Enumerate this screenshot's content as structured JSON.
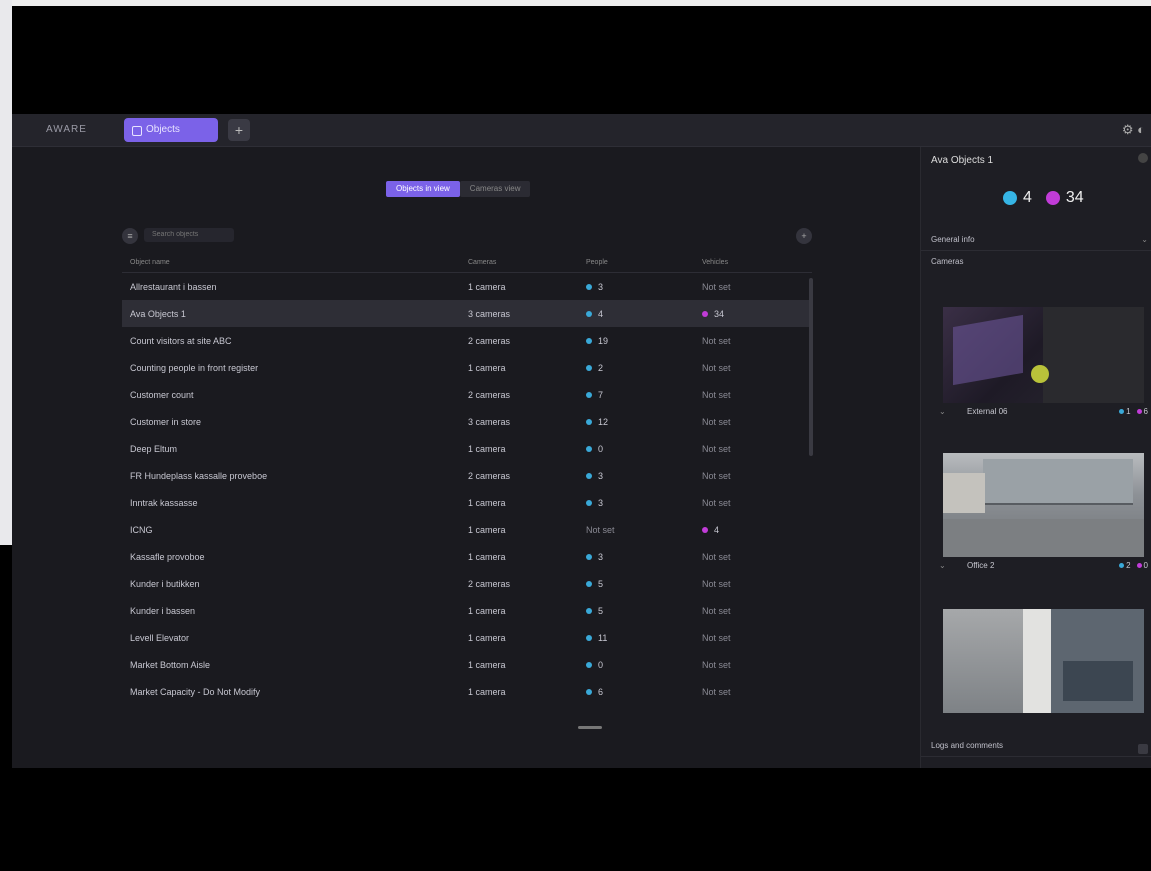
{
  "app": {
    "brand": "AWARE",
    "active_tab": "Objects",
    "add_tab_label": "+",
    "topbar_icons": [
      "settings-icon",
      "user-icon"
    ]
  },
  "view_toggle": {
    "active": "Objects in view",
    "inactive": "Cameras view"
  },
  "search": {
    "placeholder": "Search objects"
  },
  "table": {
    "headers": [
      "Object name",
      "Cameras",
      "People",
      "Vehicles"
    ],
    "rows": [
      {
        "name": "Allrestaurant i bassen",
        "cameras": "1 camera",
        "people": "3",
        "vehicles": "Not set",
        "p_dot": true,
        "v_dot": false
      },
      {
        "name": "Ava Objects 1",
        "cameras": "3 cameras",
        "people": "4",
        "vehicles": "34",
        "p_dot": true,
        "v_dot": true,
        "selected": true
      },
      {
        "name": "Count visitors at site ABC",
        "cameras": "2 cameras",
        "people": "19",
        "vehicles": "Not set",
        "p_dot": true,
        "v_dot": false
      },
      {
        "name": "Counting people in front register",
        "cameras": "1 camera",
        "people": "2",
        "vehicles": "Not set",
        "p_dot": true,
        "v_dot": false
      },
      {
        "name": "Customer count",
        "cameras": "2 cameras",
        "people": "7",
        "vehicles": "Not set",
        "p_dot": true,
        "v_dot": false
      },
      {
        "name": "Customer in store",
        "cameras": "3 cameras",
        "people": "12",
        "vehicles": "Not set",
        "p_dot": true,
        "v_dot": false
      },
      {
        "name": "Deep Eltum",
        "cameras": "1 camera",
        "people": "0",
        "vehicles": "Not set",
        "p_dot": true,
        "v_dot": false
      },
      {
        "name": "FR Hundeplass kassalle proveboe",
        "cameras": "2 cameras",
        "people": "3",
        "vehicles": "Not set",
        "p_dot": true,
        "v_dot": false
      },
      {
        "name": "Inntrak kassasse",
        "cameras": "1 camera",
        "people": "3",
        "vehicles": "Not set",
        "p_dot": true,
        "v_dot": false
      },
      {
        "name": "ICNG",
        "cameras": "1 camera",
        "people": "Not set",
        "vehicles": "4",
        "p_dot": false,
        "v_dot": true
      },
      {
        "name": "Kassafle provoboe",
        "cameras": "1 camera",
        "people": "3",
        "vehicles": "Not set",
        "p_dot": true,
        "v_dot": false
      },
      {
        "name": "Kunder i butikken",
        "cameras": "2 cameras",
        "people": "5",
        "vehicles": "Not set",
        "p_dot": true,
        "v_dot": false
      },
      {
        "name": "Kunder i bassen",
        "cameras": "1 camera",
        "people": "5",
        "vehicles": "Not set",
        "p_dot": true,
        "v_dot": false
      },
      {
        "name": "Levell Elevator",
        "cameras": "1 camera",
        "people": "11",
        "vehicles": "Not set",
        "p_dot": true,
        "v_dot": false
      },
      {
        "name": "Market Bottom Aisle",
        "cameras": "1 camera",
        "people": "0",
        "vehicles": "Not set",
        "p_dot": true,
        "v_dot": false
      },
      {
        "name": "Market Capacity - Do Not Modify",
        "cameras": "1 camera",
        "people": "6",
        "vehicles": "Not set",
        "p_dot": true,
        "v_dot": false
      }
    ]
  },
  "panel": {
    "title": "Ava Objects 1",
    "people_count": "4",
    "vehicle_count": "34",
    "sections": {
      "general": "General info",
      "cameras": "Cameras",
      "logs": "Logs and comments"
    },
    "cameras": [
      {
        "name": "",
        "people": "",
        "vehicles": ""
      },
      {
        "name": "External 06",
        "people": "1",
        "vehicles": "6"
      },
      {
        "name": "Office 2",
        "people": "2",
        "vehicles": "0"
      }
    ]
  },
  "colors": {
    "accent": "#7b62e8",
    "people": "#3aa9d8",
    "vehicles": "#c13cd8",
    "bg": "#1a1a1f"
  }
}
